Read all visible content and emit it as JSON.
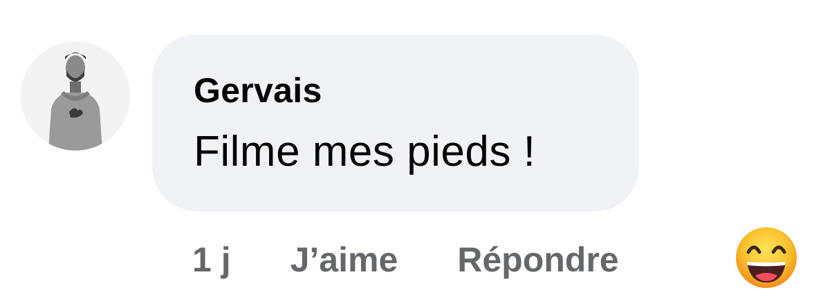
{
  "comment": {
    "author": "Gervais",
    "message": "Filme mes pieds !",
    "avatar_icon": "profile-photo-man-hoodie",
    "actions": {
      "time": "1 j",
      "like_label": "J’aime",
      "reply_label": "Répondre"
    },
    "reaction": {
      "icon": "haha-emoji",
      "color": "#f7b125"
    }
  },
  "colors": {
    "bubble_bg": "#f0f2f5",
    "text_primary": "#050505",
    "text_secondary": "#65676b"
  }
}
